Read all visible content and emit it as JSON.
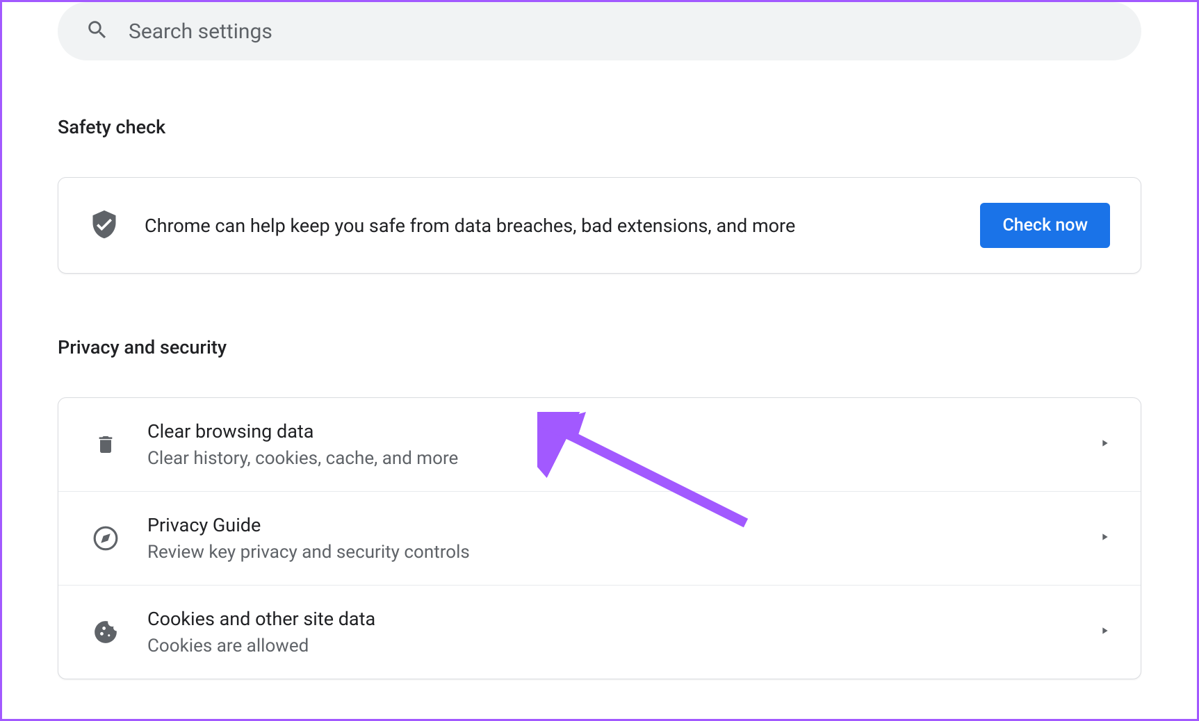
{
  "search": {
    "placeholder": "Search settings"
  },
  "safety_check": {
    "heading": "Safety check",
    "description": "Chrome can help keep you safe from data breaches, bad extensions, and more",
    "button_label": "Check now"
  },
  "privacy": {
    "heading": "Privacy and security",
    "items": [
      {
        "title": "Clear browsing data",
        "subtitle": "Clear history, cookies, cache, and more",
        "icon": "trash-icon"
      },
      {
        "title": "Privacy Guide",
        "subtitle": "Review key privacy and security controls",
        "icon": "compass-icon"
      },
      {
        "title": "Cookies and other site data",
        "subtitle": "Cookies are allowed",
        "icon": "cookie-icon"
      }
    ]
  },
  "annotation": {
    "arrow_color": "#a259ff"
  }
}
